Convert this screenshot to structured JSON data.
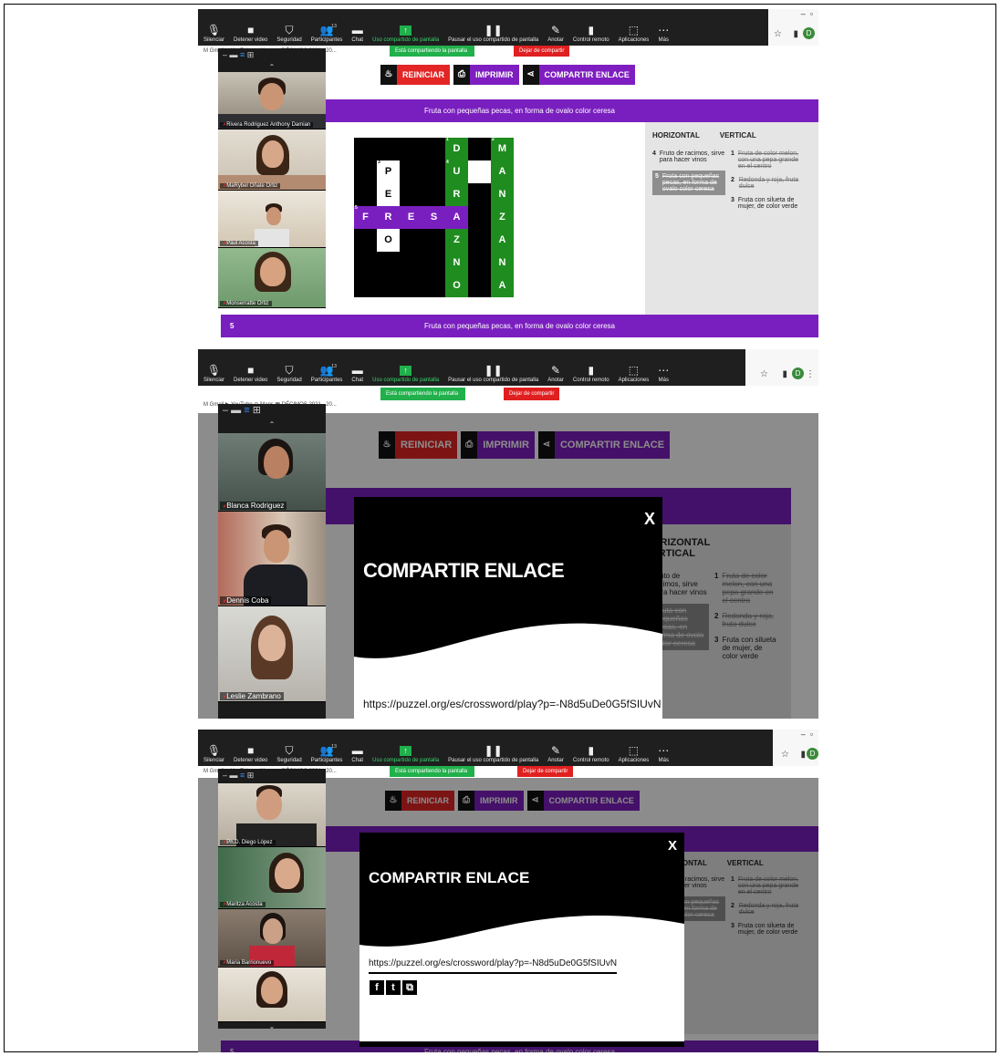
{
  "zoom_toolbar": {
    "items": [
      {
        "icon": "microphone-icon",
        "glyph": "🎙",
        "label": "Silenciar"
      },
      {
        "icon": "video-icon",
        "glyph": "■",
        "label": "Detener video"
      },
      {
        "icon": "shield-icon",
        "glyph": "⛉",
        "label": "Seguridad"
      },
      {
        "icon": "participants-icon",
        "glyph": "👥",
        "label": "Participantes"
      },
      {
        "icon": "chat-icon",
        "glyph": "▬",
        "label": "Chat"
      },
      {
        "icon": "share-screen-icon",
        "glyph": "↑",
        "label": "Uso compartido de pantalla"
      },
      {
        "icon": "pause-icon",
        "glyph": "❚❚",
        "label": "Pausar el uso compartido de pantalla"
      },
      {
        "icon": "annotate-icon",
        "glyph": "✎",
        "label": "Anotar"
      },
      {
        "icon": "mouse-icon",
        "glyph": "▮",
        "label": "Control remoto"
      },
      {
        "icon": "apps-icon",
        "glyph": "⬚",
        "label": "Aplicaciones"
      },
      {
        "icon": "more-icon",
        "glyph": "⋯",
        "label": "Más"
      }
    ],
    "participant_count": "13",
    "sharing_banner": "Está compartiendo la pantalla",
    "stop_share": "Dejar de compartir",
    "profile_letter": "D"
  },
  "bookmarks": "M Gmail   ▶ YouTube   ⊙ Maps   ▦ DÉCIMOS 2021 - 20...",
  "page": {
    "buttons": {
      "restart": "REINICIAR",
      "print": "IMPRIMIR",
      "share": "COMPARTIR ENLACE"
    },
    "clue_banner": "Fruta con pequeñas pecas, en forma de ovalo color ceresa",
    "bottom_clue_number": "5",
    "horizontal_heading": "HORIZONTAL",
    "vertical_heading": "VERTICAL",
    "horizontal": [
      {
        "n": "4",
        "text": "Fruto de racimos, sirve para hacer vinos"
      },
      {
        "n": "5",
        "text": "Fruta con pequeñas pecas, en forma de ovalo color ceresa"
      }
    ],
    "vertical": [
      {
        "n": "1",
        "text": "Fruta de color melon, con una pepa grande en el centro"
      },
      {
        "n": "2",
        "text": "Redonda y roja, fruta dulce"
      },
      {
        "n": "3",
        "text": "Fruta con silueta de mujer, de color verde"
      }
    ]
  },
  "crossword": {
    "rows": [
      [
        "",
        "",
        "",
        "",
        "D",
        "",
        "M"
      ],
      [
        "",
        "P",
        "",
        "",
        "U",
        "",
        "A"
      ],
      [
        "",
        "E",
        "",
        "",
        "R",
        "",
        "N"
      ],
      [
        "F",
        "R",
        "E",
        "S",
        "A",
        "",
        "Z"
      ],
      [
        "",
        "O",
        "",
        "",
        "Z",
        "",
        "A"
      ],
      [
        "",
        "",
        "",
        "",
        "N",
        "",
        "N"
      ],
      [
        "",
        "",
        "",
        "",
        "O",
        "",
        "A"
      ]
    ]
  },
  "participants": {
    "shot1": [
      "Rivera Rodriguez Anthony Damian",
      "MaRybel Oñate Ortiz",
      "Paul Acosta",
      "Monserratte Ortiz"
    ],
    "shot2": [
      "Blanca Rodriguez",
      "Dennis Coba",
      "Leslie Zambrano"
    ],
    "shot3": [
      "Ph.D. Diego López",
      "Maritza Acosta",
      "Maria Barrionuevo",
      ""
    ]
  },
  "modal": {
    "close": "X",
    "title": "COMPARTIR ENLACE",
    "url": "https://puzzel.org/es/crossword/play?p=-N8d5uDe0G5fSIUvN",
    "social": [
      "f",
      "t",
      "⧉"
    ]
  }
}
